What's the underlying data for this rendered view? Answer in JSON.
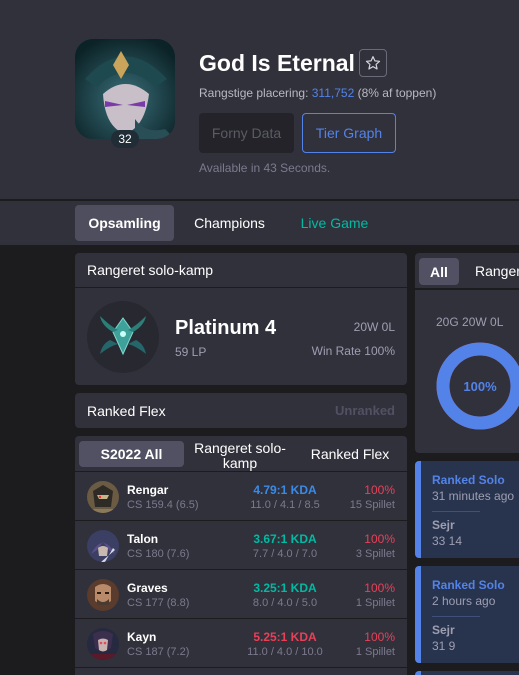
{
  "profile": {
    "name": "God Is Eternal",
    "level": "32",
    "ladder_label": "Rangstige placering:",
    "ladder_rank": "311,752",
    "ladder_pct": "(8% af toppen)",
    "btn_refresh": "Forny Data",
    "btn_tier": "Tier Graph",
    "available_text": "Available in 43 Seconds."
  },
  "tabs": {
    "overview": "Opsamling",
    "champions": "Champions",
    "live": "Live Game"
  },
  "solo_rank": {
    "title": "Rangeret solo-kamp",
    "tier": "Platinum 4",
    "lp": "59 LP",
    "record": "20W 0L",
    "winrate": "Win Rate 100%"
  },
  "flex_rank": {
    "title": "Ranked Flex",
    "status": "Unranked"
  },
  "champ_stats": {
    "tabs": {
      "season": "S2022 All",
      "solo": "Rangeret solo-kamp",
      "flex": "Ranked Flex"
    },
    "rows": [
      {
        "name": "Rengar",
        "cs": "CS 159.4 (6.5)",
        "kda": "4.79:1 KDA",
        "kda_detail": "11.0 / 4.1 / 8.5",
        "winrate": "100%",
        "games": "15 Spillet",
        "kda_color": "#3a8be8"
      },
      {
        "name": "Talon",
        "cs": "CS 180 (7.6)",
        "kda": "3.67:1 KDA",
        "kda_detail": "7.7 / 4.0 / 7.0",
        "winrate": "100%",
        "games": "3 Spillet",
        "kda_color": "#00bba3"
      },
      {
        "name": "Graves",
        "cs": "CS 177 (8.8)",
        "kda": "3.25:1 KDA",
        "kda_detail": "8.0 / 4.0 / 5.0",
        "winrate": "100%",
        "games": "1 Spillet",
        "kda_color": "#00bba3"
      },
      {
        "name": "Kayn",
        "cs": "CS 187 (7.2)",
        "kda": "5.25:1 KDA",
        "kda_detail": "11.0 / 4.0 / 10.0",
        "winrate": "100%",
        "games": "1 Spillet",
        "kda_color": "#e84057"
      }
    ]
  },
  "recent": {
    "tab_all": "All",
    "tab_ranked": "Ranger",
    "summary": "20G 20W 0L",
    "winrate_label": "100%",
    "winrate_value": 100
  },
  "matches": [
    {
      "queue": "Ranked Solo",
      "time": "31 minutes ago",
      "result": "Sejr",
      "duration": "33 14"
    },
    {
      "queue": "Ranked Solo",
      "time": "2 hours ago",
      "result": "Sejr",
      "duration": "31 9"
    }
  ],
  "colors": {
    "accent": "#5383e8",
    "teal": "#00bba3",
    "red": "#e84057",
    "panel": "#31313c",
    "background": "#1c1c1f"
  }
}
